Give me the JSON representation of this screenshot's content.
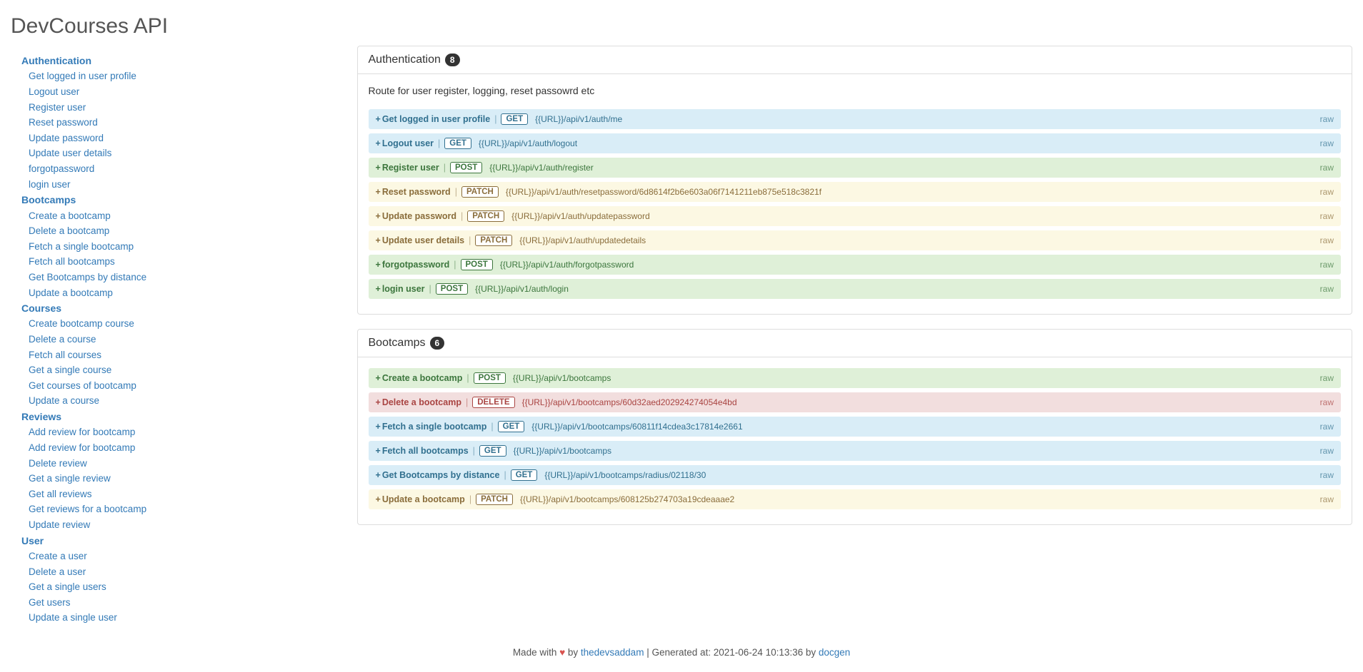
{
  "page_title": "DevCourses API",
  "sections": [
    {
      "key": "auth",
      "title": "Authentication",
      "count": "8",
      "desc": "Route for user register, logging, reset passowrd etc",
      "items": [
        {
          "name": "Get logged in user profile",
          "method": "GET",
          "url": "{{URL}}/api/v1/auth/me"
        },
        {
          "name": "Logout user",
          "method": "GET",
          "url": "{{URL}}/api/v1/auth/logout"
        },
        {
          "name": "Register user",
          "method": "POST",
          "url": "{{URL}}/api/v1/auth/register"
        },
        {
          "name": "Reset password",
          "method": "PATCH",
          "url": "{{URL}}/api/v1/auth/resetpassword/6d8614f2b6e603a06f7141211eb875e518c3821f"
        },
        {
          "name": "Update password",
          "method": "PATCH",
          "url": "{{URL}}/api/v1/auth/updatepassword"
        },
        {
          "name": "Update user details",
          "method": "PATCH",
          "url": "{{URL}}/api/v1/auth/updatedetails"
        },
        {
          "name": "forgotpassword",
          "method": "POST",
          "url": "{{URL}}/api/v1/auth/forgotpassword"
        },
        {
          "name": "login user",
          "method": "POST",
          "url": "{{URL}}/api/v1/auth/login"
        }
      ]
    },
    {
      "key": "bootcamps",
      "title": "Bootcamps",
      "count": "6",
      "desc": "",
      "items": [
        {
          "name": "Create a bootcamp",
          "method": "POST",
          "url": "{{URL}}/api/v1/bootcamps"
        },
        {
          "name": "Delete a bootcamp",
          "method": "DELETE",
          "url": "{{URL}}/api/v1/bootcamps/60d32aed202924274054e4bd"
        },
        {
          "name": "Fetch a single bootcamp",
          "method": "GET",
          "url": "{{URL}}/api/v1/bootcamps/60811f14cdea3c17814e2661"
        },
        {
          "name": "Fetch all bootcamps",
          "method": "GET",
          "url": "{{URL}}/api/v1/bootcamps"
        },
        {
          "name": "Get Bootcamps by distance",
          "method": "GET",
          "url": "{{URL}}/api/v1/bootcamps/radius/02118/30"
        },
        {
          "name": "Update a bootcamp",
          "method": "PATCH",
          "url": "{{URL}}/api/v1/bootcamps/608125b274703a19cdeaaae2"
        }
      ]
    },
    {
      "key": "courses",
      "title": "Courses",
      "items_names": [
        "Create bootcamp course",
        "Delete a course",
        "Fetch all courses",
        "Get a single course",
        "Get courses of bootcamp",
        "Update a course"
      ]
    },
    {
      "key": "reviews",
      "title": "Reviews",
      "items_names": [
        "Add review for bootcamp",
        "Add review for bootcamp",
        "Delete review",
        "Get a single review",
        "Get all reviews",
        "Get reviews for a bootcamp",
        "Update review"
      ]
    },
    {
      "key": "user",
      "title": "User",
      "items_names": [
        "Create a user",
        "Delete a user",
        "Get a single users",
        "Get users",
        "Update a single user"
      ]
    }
  ],
  "labels": {
    "raw": "raw",
    "expand": "+",
    "sep": "|"
  },
  "footer": {
    "made_with": "Made with ",
    "heart": "♥",
    "by": " by ",
    "author": "thedevsaddam",
    "sep": " | ",
    "generated": "Generated at: 2021-06-24 10:13:36 by ",
    "tool": "docgen"
  }
}
